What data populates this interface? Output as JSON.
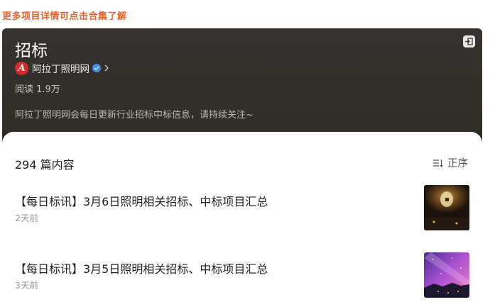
{
  "top_link": "更多项目详情可点击合集了解",
  "header": {
    "title": "招标",
    "author": "阿拉丁照明网",
    "logo_letter": "A",
    "reads": "阅读 1.9万",
    "description": "阿拉丁照明网会每日更新行业招标中标信息，请持续关注~"
  },
  "list": {
    "count_label": "294 篇内容",
    "sort_label": "正序",
    "articles": [
      {
        "title": "【每日标讯】3月6日照明相关招标、中标项目汇总",
        "time": "2天前"
      },
      {
        "title": "【每日标讯】3月5日照明相关招标、中标项目汇总",
        "time": "3天前"
      }
    ]
  },
  "colors": {
    "link": "#e8632e",
    "header_bg": "#332f29",
    "logo": "#d8282c",
    "verified": "#3b8df0"
  },
  "icons": [
    "exit-icon",
    "verified-icon",
    "chevron-right-icon",
    "sort-icon"
  ]
}
